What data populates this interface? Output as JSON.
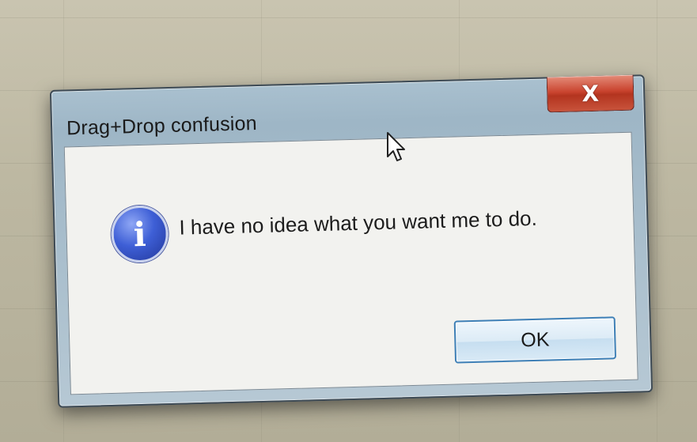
{
  "dialog": {
    "title": "Drag+Drop confusion",
    "message": "I have no idea what you want me to do.",
    "ok_label": "OK",
    "close_label": "X",
    "icon": "info-icon",
    "icon_glyph": "i"
  },
  "cursor": {
    "icon": "arrow-cursor-icon"
  },
  "colors": {
    "close_button": "#c9432e",
    "info_icon": "#3e5fd6",
    "ok_border": "#3d7fb6",
    "title_bar": "#a9c0cf"
  }
}
